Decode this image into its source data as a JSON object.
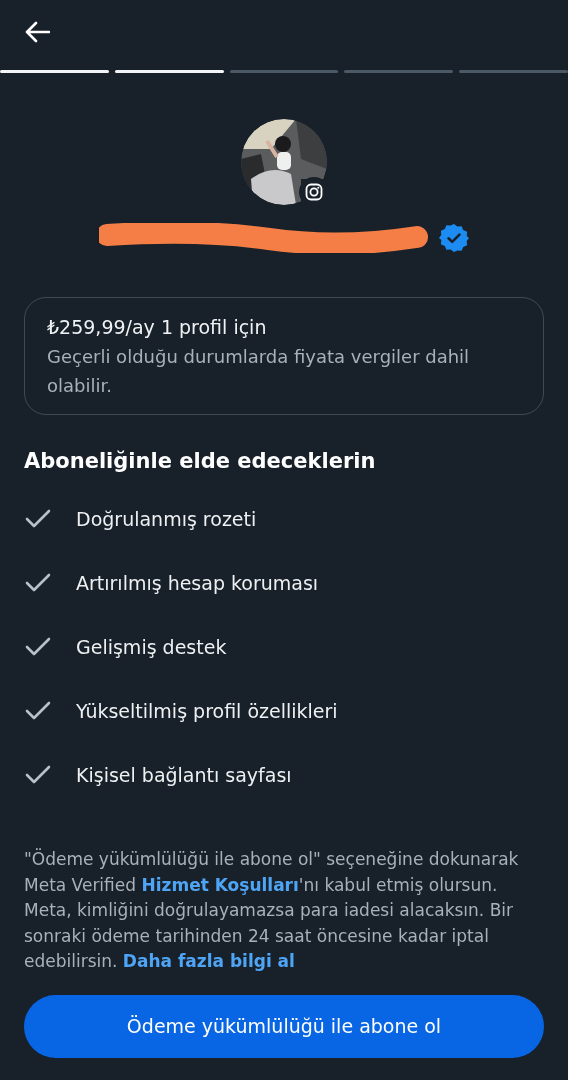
{
  "progress": [
    {
      "done": true
    },
    {
      "done": true
    },
    {
      "done": false
    },
    {
      "done": false
    },
    {
      "done": false
    }
  ],
  "profile": {
    "verified": true,
    "name_redacted": true
  },
  "price_card": {
    "price": "₺259,99/ay 1 profil için",
    "note": "Geçerli olduğu durumlarda fiyata vergiler dahil olabilir."
  },
  "benefits_title": "Aboneliğinle elde edeceklerin",
  "benefits": [
    {
      "label": "Doğrulanmış rozeti",
      "checked": true
    },
    {
      "label": "Artırılmış hesap koruması",
      "checked": true
    },
    {
      "label": "Gelişmiş destek",
      "checked": true
    },
    {
      "label": "Yükseltilmiş profil özellikleri",
      "checked": true
    },
    {
      "label": "Kişisel bağlantı sayfası",
      "checked": true
    }
  ],
  "disclaimer": [
    {
      "kind": "text",
      "text": "\"Ödeme yükümlülüğü ile abone ol\" seçeneğine dokunarak Meta Verified "
    },
    {
      "kind": "link",
      "text": "Hizmet Koşulları"
    },
    {
      "kind": "text",
      "text": "'nı kabul etmiş olursun. Meta, kimliğini doğrulayamazsa para iadesi alacaksın. Bir sonraki ödeme tarihinden 24 saat öncesine kadar iptal edebilirsin. "
    },
    {
      "kind": "link",
      "text": "Daha fazla bilgi al"
    }
  ],
  "subscribe_button": "Ödeme yükümlülüğü ile abone ol"
}
